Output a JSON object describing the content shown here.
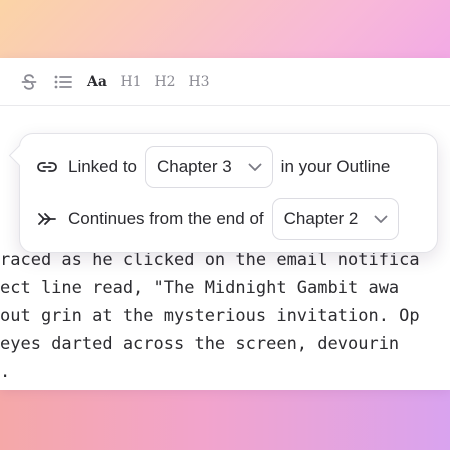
{
  "toolbar": {
    "items": [
      {
        "label": "",
        "icon": "strikethrough-icon"
      },
      {
        "label": "",
        "icon": "bullet-list-icon"
      },
      {
        "label": "Aa",
        "icon": "text-style"
      },
      {
        "label": "H1"
      },
      {
        "label": "H2"
      },
      {
        "label": "H3"
      }
    ]
  },
  "popover": {
    "link_row": {
      "icon": "link-icon",
      "prefix": "Linked to",
      "selected": "Chapter 3",
      "suffix": "in your Outline"
    },
    "continue_row": {
      "icon": "double-chevron-arrow-icon",
      "prefix": "Continues from the end of",
      "selected": "Chapter 2"
    }
  },
  "body_text": {
    "lines": [
      "raced as he clicked on the email notifica",
      "ect line read, \"The Midnight Gambit awa",
      "out grin at the mysterious invitation. Op",
      "eyes darted across the screen, devourin",
      "."
    ]
  },
  "colors": {
    "text": "#2b2b30",
    "muted_icon": "#8a8a93",
    "border": "#dcdce2"
  }
}
